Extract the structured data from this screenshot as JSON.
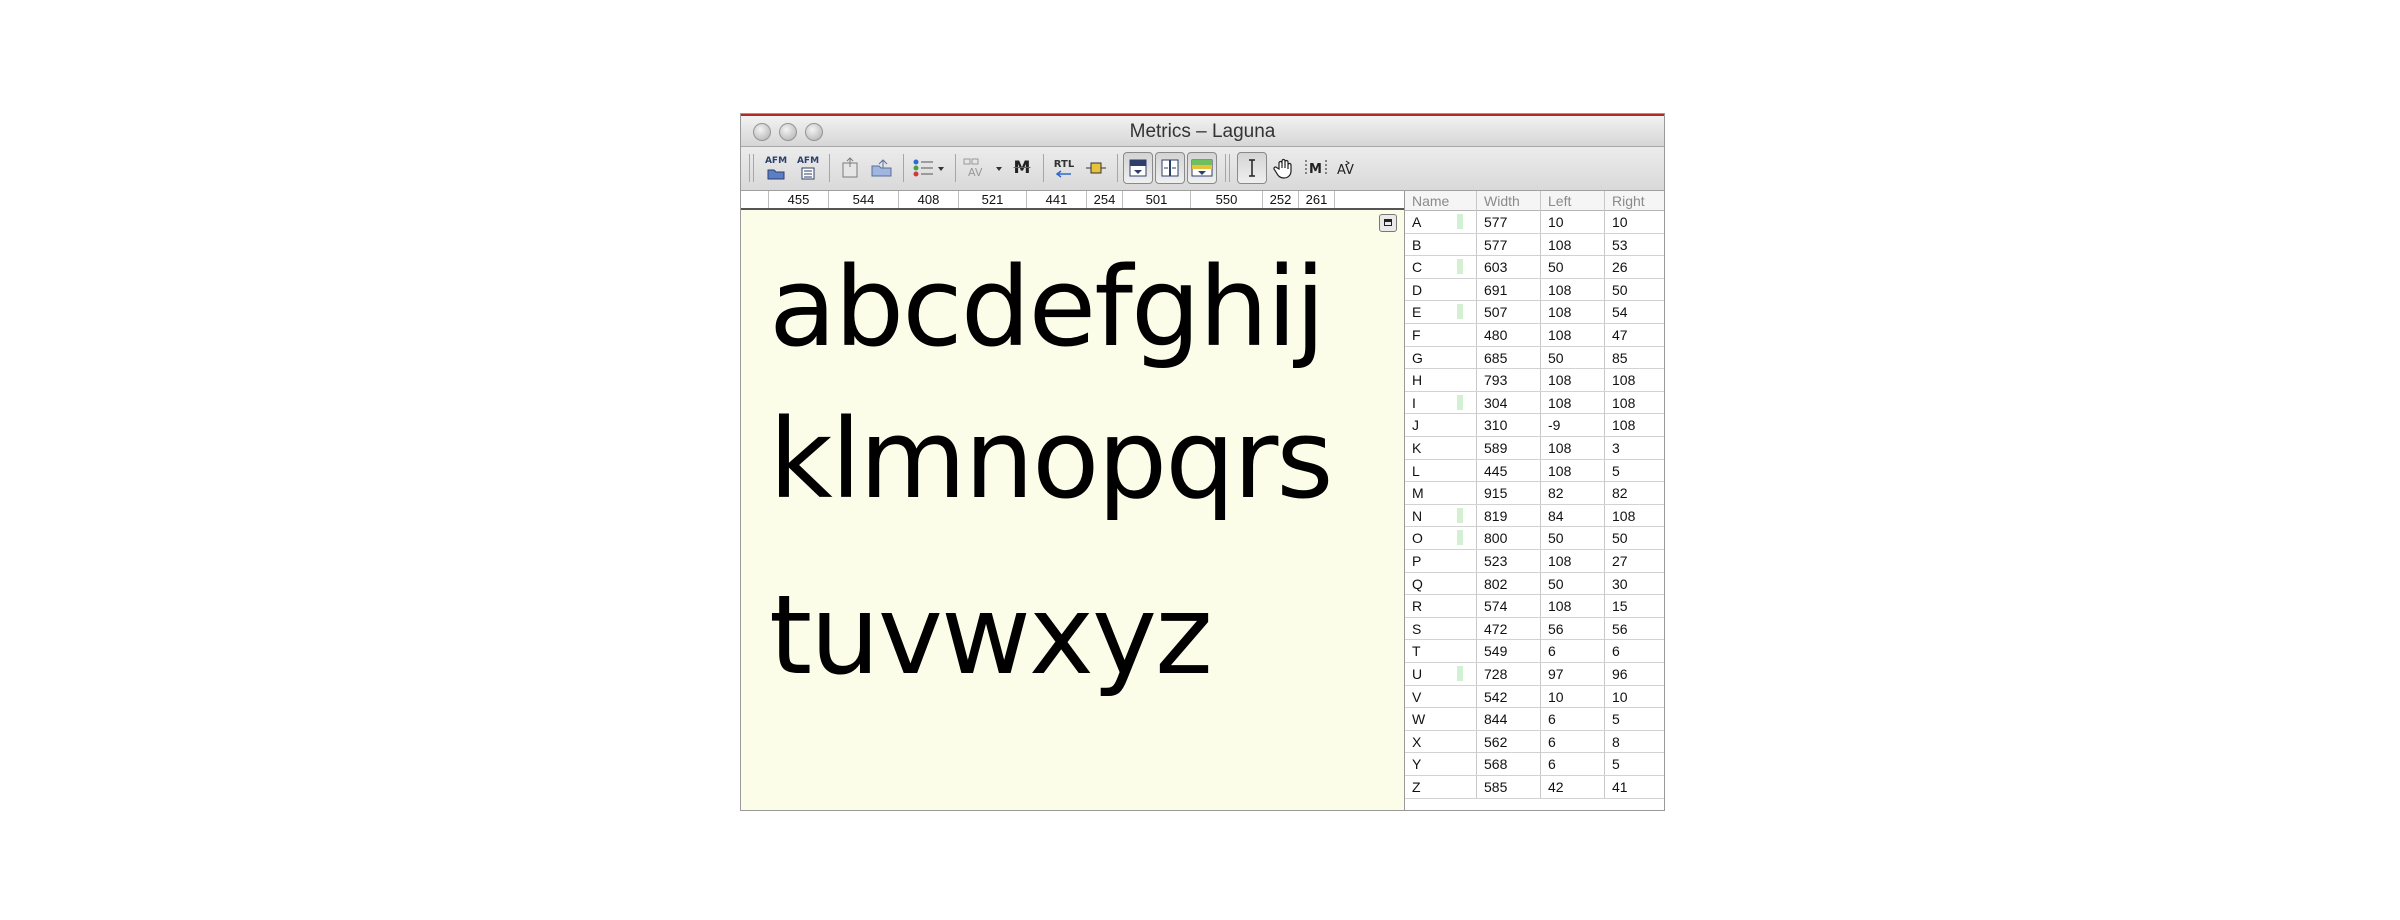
{
  "window": {
    "title": "Metrics – Laguna"
  },
  "toolbar": {
    "import_afm_label": "AFM",
    "export_afm_label": "AFM",
    "rtl_label": "RTL",
    "metrics_label": "M",
    "kern_label": "AV"
  },
  "ruler": {
    "widths": [
      "455",
      "544",
      "408",
      "521",
      "441",
      "254",
      "501",
      "550",
      "252",
      "261"
    ]
  },
  "preview": {
    "lines": [
      "abcdefghij",
      "klmnopqrs",
      "tuvwxyz"
    ]
  },
  "metrics": {
    "headers": [
      "Name",
      "Width",
      "Left",
      "Right"
    ],
    "rows": [
      {
        "name": "A",
        "width": "577",
        "left": "10",
        "right": "10",
        "marked": true
      },
      {
        "name": "B",
        "width": "577",
        "left": "108",
        "right": "53",
        "marked": false
      },
      {
        "name": "C",
        "width": "603",
        "left": "50",
        "right": "26",
        "marked": true
      },
      {
        "name": "D",
        "width": "691",
        "left": "108",
        "right": "50",
        "marked": false
      },
      {
        "name": "E",
        "width": "507",
        "left": "108",
        "right": "54",
        "marked": true
      },
      {
        "name": "F",
        "width": "480",
        "left": "108",
        "right": "47",
        "marked": false
      },
      {
        "name": "G",
        "width": "685",
        "left": "50",
        "right": "85",
        "marked": false
      },
      {
        "name": "H",
        "width": "793",
        "left": "108",
        "right": "108",
        "marked": false
      },
      {
        "name": "I",
        "width": "304",
        "left": "108",
        "right": "108",
        "marked": true
      },
      {
        "name": "J",
        "width": "310",
        "left": "-9",
        "right": "108",
        "marked": false
      },
      {
        "name": "K",
        "width": "589",
        "left": "108",
        "right": "3",
        "marked": false
      },
      {
        "name": "L",
        "width": "445",
        "left": "108",
        "right": "5",
        "marked": false
      },
      {
        "name": "M",
        "width": "915",
        "left": "82",
        "right": "82",
        "marked": false
      },
      {
        "name": "N",
        "width": "819",
        "left": "84",
        "right": "108",
        "marked": true
      },
      {
        "name": "O",
        "width": "800",
        "left": "50",
        "right": "50",
        "marked": true
      },
      {
        "name": "P",
        "width": "523",
        "left": "108",
        "right": "27",
        "marked": false
      },
      {
        "name": "Q",
        "width": "802",
        "left": "50",
        "right": "30",
        "marked": false
      },
      {
        "name": "R",
        "width": "574",
        "left": "108",
        "right": "15",
        "marked": false
      },
      {
        "name": "S",
        "width": "472",
        "left": "56",
        "right": "56",
        "marked": false
      },
      {
        "name": "T",
        "width": "549",
        "left": "6",
        "right": "6",
        "marked": false
      },
      {
        "name": "U",
        "width": "728",
        "left": "97",
        "right": "96",
        "marked": true
      },
      {
        "name": "V",
        "width": "542",
        "left": "10",
        "right": "10",
        "marked": false
      },
      {
        "name": "W",
        "width": "844",
        "left": "6",
        "right": "5",
        "marked": false
      },
      {
        "name": "X",
        "width": "562",
        "left": "6",
        "right": "8",
        "marked": false
      },
      {
        "name": "Y",
        "width": "568",
        "left": "6",
        "right": "5",
        "marked": false
      },
      {
        "name": "Z",
        "width": "585",
        "left": "42",
        "right": "41",
        "marked": false
      }
    ]
  },
  "colors": {
    "canvas_background": "#fcfde8",
    "titlebar_accent": "#b02a2a",
    "row_mark": "#d3f0d2"
  }
}
